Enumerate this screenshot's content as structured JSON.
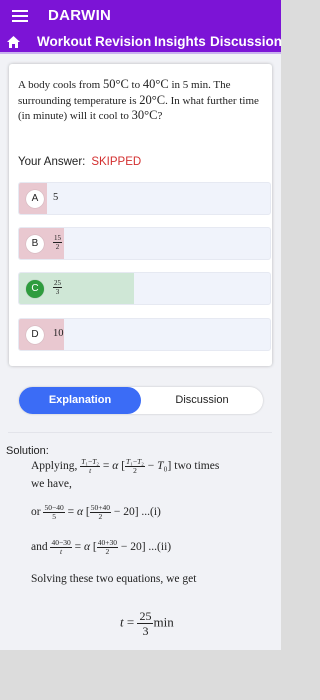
{
  "app": {
    "title": "DARWIN"
  },
  "nav": {
    "tabs": [
      "Workout",
      "Revision",
      "Insights",
      "Discussion"
    ]
  },
  "question": {
    "text_1": "A body cools from ",
    "t1": "50°C",
    "text_2": " to ",
    "t2": "40°C",
    "text_3": " in 5 min. The surrounding temperature is ",
    "t0": "20°C",
    "text_4": ". In what further time (in minute) will it cool to ",
    "t3": "30°C",
    "text_5": "?"
  },
  "answer": {
    "label": "Your Answer:",
    "status": "SKIPPED"
  },
  "options": [
    {
      "letter": "A",
      "value": "5",
      "fill_fraction": 0.11,
      "state": "wrong"
    },
    {
      "letter": "B",
      "num": "15",
      "den": "2",
      "fill_fraction": 0.18,
      "state": "wrong"
    },
    {
      "letter": "C",
      "num": "25",
      "den": "3",
      "fill_fraction": 0.46,
      "state": "correct"
    },
    {
      "letter": "D",
      "value": "10",
      "fill_fraction": 0.18,
      "state": "wrong"
    }
  ],
  "tabs": {
    "explanation": "Explanation",
    "discussion": "Discussion"
  },
  "solution": {
    "label": "Solution:",
    "line1_a": "Applying,",
    "line1_b": "two times",
    "line2": "we have,",
    "or": "or",
    "eq1_tail": "...(i)",
    "and": "and",
    "eq2_tail": "...(ii)",
    "solving": "Solving these two equations, we get",
    "result_var": "t",
    "result_num": "25",
    "result_den": "3",
    "result_unit": "min"
  },
  "colors": {
    "header": "#7c14d6",
    "accent": "#3b6cf6",
    "wrong_fill": "#e9c8d0",
    "correct_fill": "#cfe7d6",
    "correct_badge": "#2e9c3e",
    "skipped": "#d32f2f"
  }
}
